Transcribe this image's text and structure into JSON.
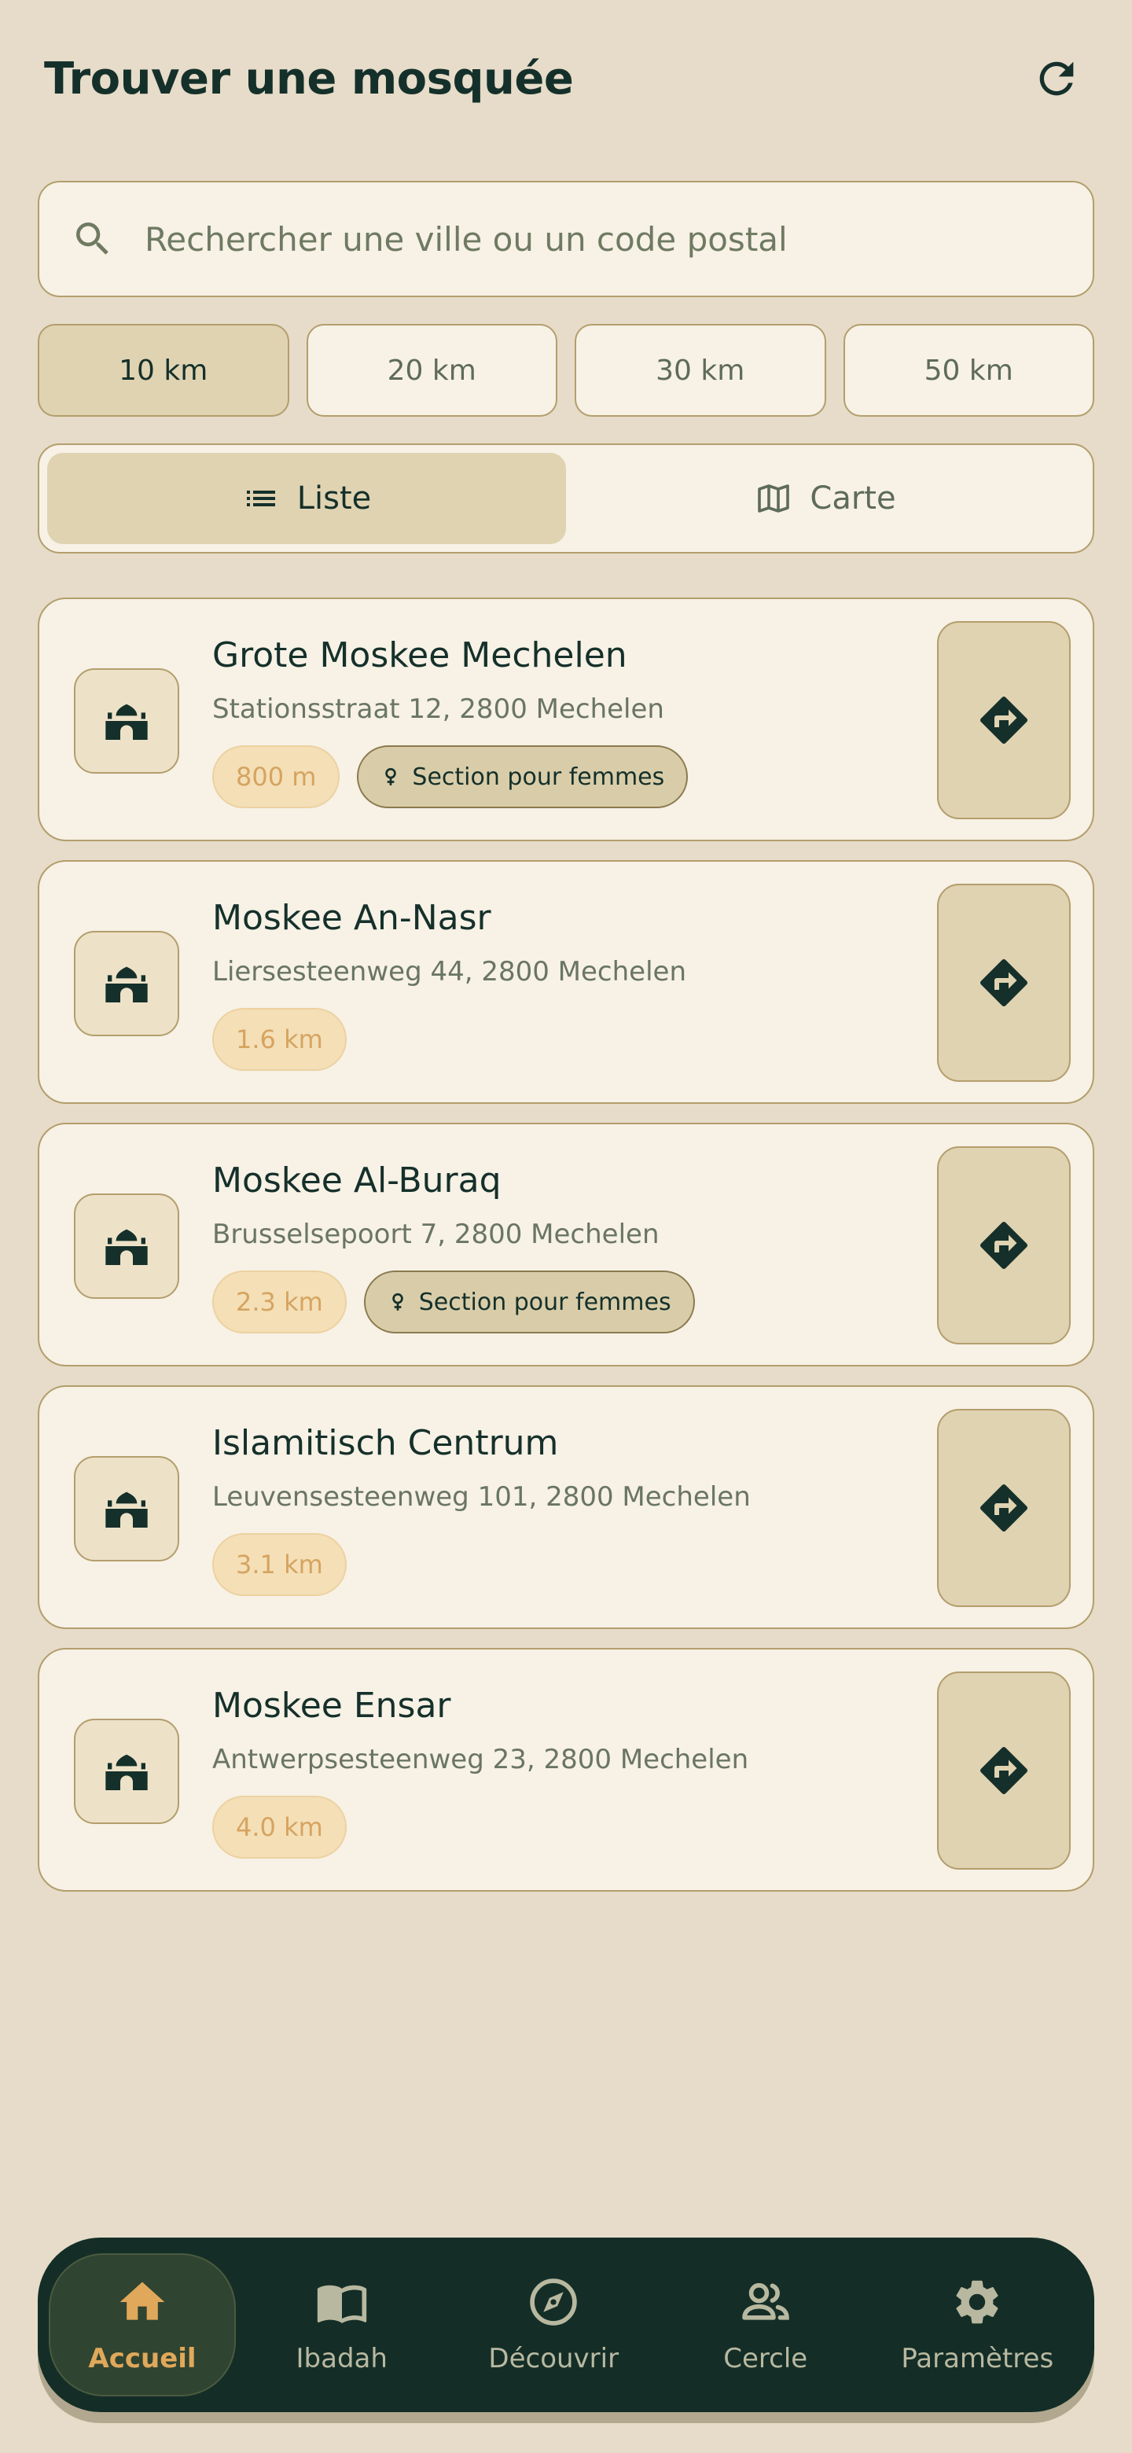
{
  "header": {
    "title": "Trouver une mosquée",
    "refresh_icon": "refresh-icon"
  },
  "search": {
    "placeholder": "Rechercher une ville ou un code postal",
    "icon": "search-icon"
  },
  "radius_options": [
    {
      "label": "10 km",
      "selected": true
    },
    {
      "label": "20 km",
      "selected": false
    },
    {
      "label": "30 km",
      "selected": false
    },
    {
      "label": "50 km",
      "selected": false
    }
  ],
  "view_toggle": {
    "list_label": "Liste",
    "map_label": "Carte",
    "selected": "list"
  },
  "mosques": [
    {
      "name": "Grote Moskee Mechelen",
      "address": "Stationsstraat 12, 2800 Mechelen",
      "distance": "800 m",
      "women_section": "Section pour femmes"
    },
    {
      "name": "Moskee An-Nasr",
      "address": "Liersesteenweg 44, 2800 Mechelen",
      "distance": "1.6 km",
      "women_section": null
    },
    {
      "name": "Moskee Al-Buraq",
      "address": "Brusselsepoort 7, 2800 Mechelen",
      "distance": "2.3 km",
      "women_section": "Section pour femmes"
    },
    {
      "name": "Islamitisch Centrum",
      "address": "Leuvensesteenweg 101, 2800 Mechelen",
      "distance": "3.1 km",
      "women_section": null
    },
    {
      "name": "Moskee Ensar",
      "address": "Antwerpsesteenweg 23, 2800 Mechelen",
      "distance": "4.0 km",
      "women_section": null
    }
  ],
  "bottom_nav": [
    {
      "label": "Accueil",
      "icon": "home-icon",
      "active": true
    },
    {
      "label": "Ibadah",
      "icon": "book-icon",
      "active": false
    },
    {
      "label": "Découvrir",
      "icon": "compass-icon",
      "active": false
    },
    {
      "label": "Cercle",
      "icon": "people-icon",
      "active": false
    },
    {
      "label": "Paramètres",
      "icon": "gear-icon",
      "active": false
    }
  ],
  "colors": {
    "background": "#e6dcc9",
    "card": "#f7f1e6",
    "accent_dark": "#142e27",
    "accent_gold": "#e0a85a",
    "chip_active": "#e0d3b2"
  }
}
